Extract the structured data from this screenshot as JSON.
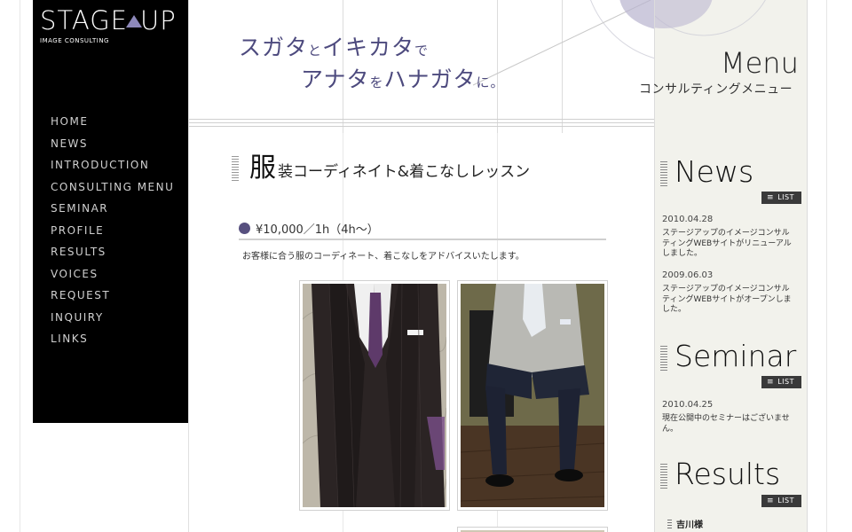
{
  "brand": {
    "logo_left": "STAGE",
    "logo_right": "UP",
    "tagline": "IMAGE CONSULTING"
  },
  "nav": {
    "items": [
      {
        "label": "HOME"
      },
      {
        "label": "NEWS"
      },
      {
        "label": "INTRODUCTION"
      },
      {
        "label": "CONSULTING MENU"
      },
      {
        "label": "SEMINAR"
      },
      {
        "label": "PROFILE"
      },
      {
        "label": "RESULTS"
      },
      {
        "label": "VOICES"
      },
      {
        "label": "REQUEST"
      },
      {
        "label": "INQUIRY"
      },
      {
        "label": "LINKS"
      }
    ]
  },
  "header": {
    "line1_a": "スガタ",
    "line1_b": "と",
    "line1_c": "イキカタ",
    "line1_d": "で",
    "line2_a": "アナタ",
    "line2_b": "を",
    "line2_c": "ハナガタ",
    "line2_d": "に。",
    "accent_color": "#4d4a7e"
  },
  "menu": {
    "title": "Menu",
    "subtitle": "コンサルティングメニュー"
  },
  "content": {
    "heading_big": "服",
    "heading_rest": "装コーディネイト&着こなしレッスン",
    "price": "¥10,000／1h（4h〜）",
    "description": "お客様に合う服のコーディネート、着こなしをアドバイスいたします。"
  },
  "right": {
    "list_label": "LIST",
    "news": {
      "title": "News",
      "entries": [
        {
          "date": "2010.04.28",
          "text": "ステージアップのイメージコンサルティングWEBサイトがリニューアルしました。"
        },
        {
          "date": "2009.06.03",
          "text": "ステージアップのイメージコンサルティングWEBサイトがオープンしました。"
        }
      ]
    },
    "seminar": {
      "title": "Seminar",
      "entries": [
        {
          "date": "2010.04.25",
          "text": "現在公開中のセミナーはございません。"
        }
      ]
    },
    "results": {
      "title": "Results",
      "entries": [
        {
          "name": "吉川様"
        }
      ]
    }
  }
}
